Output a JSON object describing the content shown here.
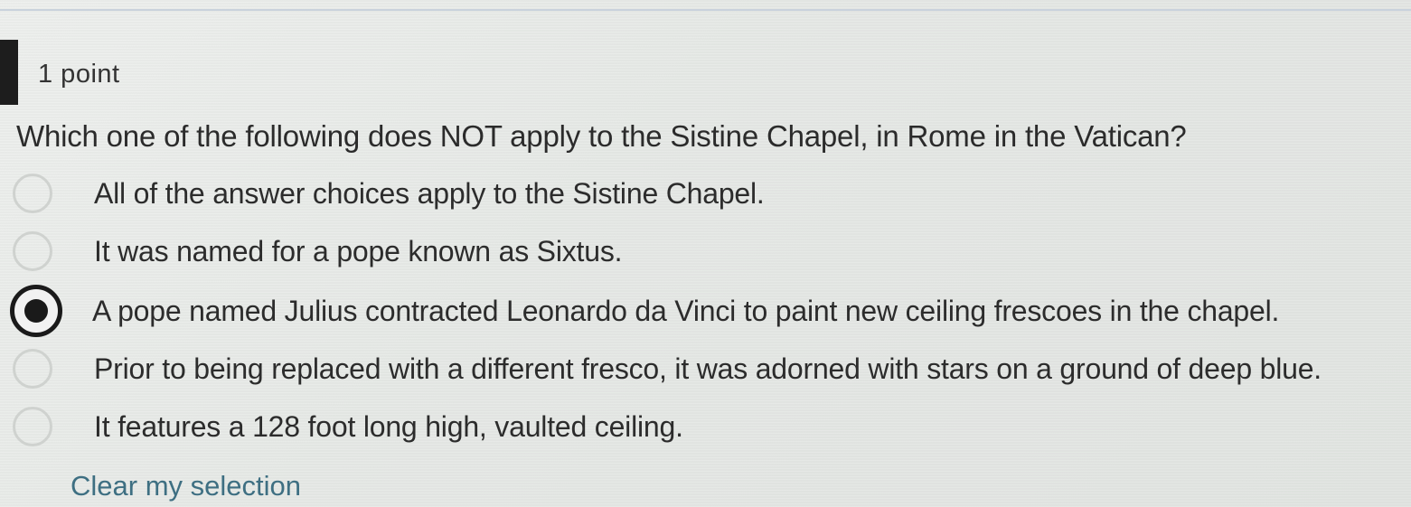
{
  "question": {
    "points": "1 point",
    "text": "Which one of the following does NOT apply to the Sistine Chapel, in Rome in the Vatican?",
    "options": [
      {
        "label": "All of the answer choices apply to the Sistine Chapel.",
        "selected": false
      },
      {
        "label": "It was named for a pope known as Sixtus.",
        "selected": false
      },
      {
        "label": "A pope named Julius contracted Leonardo da Vinci to paint new ceiling frescoes in the chapel.",
        "selected": true
      },
      {
        "label": "Prior to being replaced with a different fresco, it was adorned with stars on a ground of deep blue.",
        "selected": false
      },
      {
        "label": "It features a 128 foot long high, vaulted ceiling.",
        "selected": false
      }
    ],
    "clear_label": "Clear my selection"
  },
  "colors": {
    "link": "#3e6f82",
    "selected_radio": "#1a1a1a",
    "unselected_radio_border": "#cfd2cf",
    "left_marker": "#1d1d1d"
  }
}
